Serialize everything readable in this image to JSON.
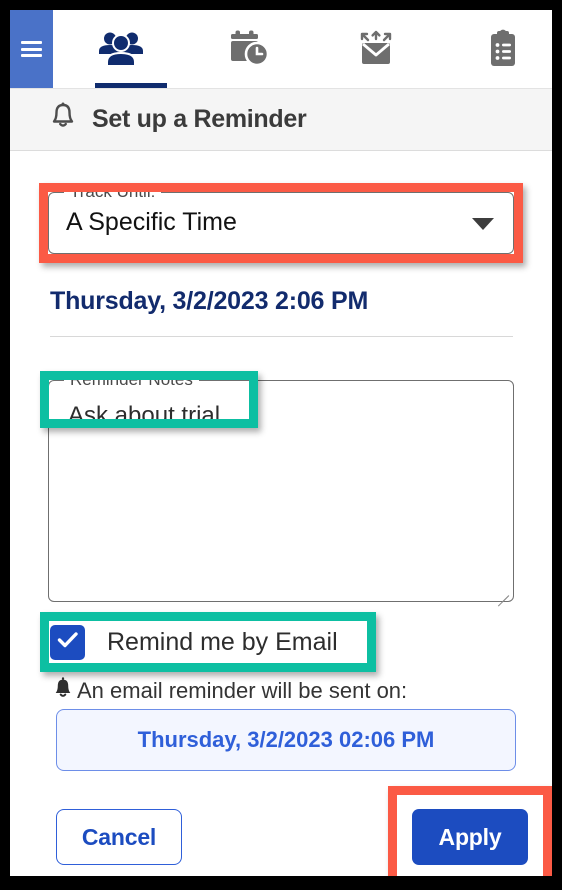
{
  "nav": {
    "menu_button": "menu-hamburger",
    "tabs": [
      {
        "icon": "people-group-icon",
        "name": "contacts",
        "active": true
      },
      {
        "icon": "calendar-clock-icon",
        "name": "scheduling",
        "active": false
      },
      {
        "icon": "envelope-send-icon",
        "name": "campaigns",
        "active": false
      },
      {
        "icon": "clipboard-list-icon",
        "name": "tasks",
        "active": false
      }
    ]
  },
  "header": {
    "icon": "bell-icon",
    "title": "Set up a Reminder"
  },
  "form": {
    "track_until": {
      "legend": "Track Until:",
      "value": "A Specific Time",
      "caret_icon": "chevron-down-icon",
      "options": [
        "A Specific Time"
      ]
    },
    "due_date": "Thursday, 3/2/2023 2:06 PM",
    "notes": {
      "legend": "Reminder Notes",
      "value": "Ask about trial",
      "placeholder": ""
    },
    "remind_by_email": {
      "label": "Remind me by Email",
      "checked": true,
      "check_icon": "checkmark-icon"
    },
    "email_notice": {
      "icon": "bell-icon",
      "text": "An email reminder will be sent on:",
      "scheduled_value": "Thursday, 3/2/2023 02:06 PM"
    }
  },
  "footer": {
    "cancel_label": "Cancel",
    "apply_label": "Apply"
  },
  "annotations": {
    "red_color": "#fb5a45",
    "teal_color": "#0dbfa2",
    "highlighted_red": [
      "track-until-select",
      "apply-button"
    ],
    "highlighted_teal": [
      "reminder-notes-label",
      "remind-by-email-checkbox"
    ]
  },
  "colors": {
    "accent_blue": "#1c4cc0",
    "nav_active": "#102c6e",
    "menu_blue": "#4a72c8",
    "icon_gray": "#6e6e6e"
  }
}
